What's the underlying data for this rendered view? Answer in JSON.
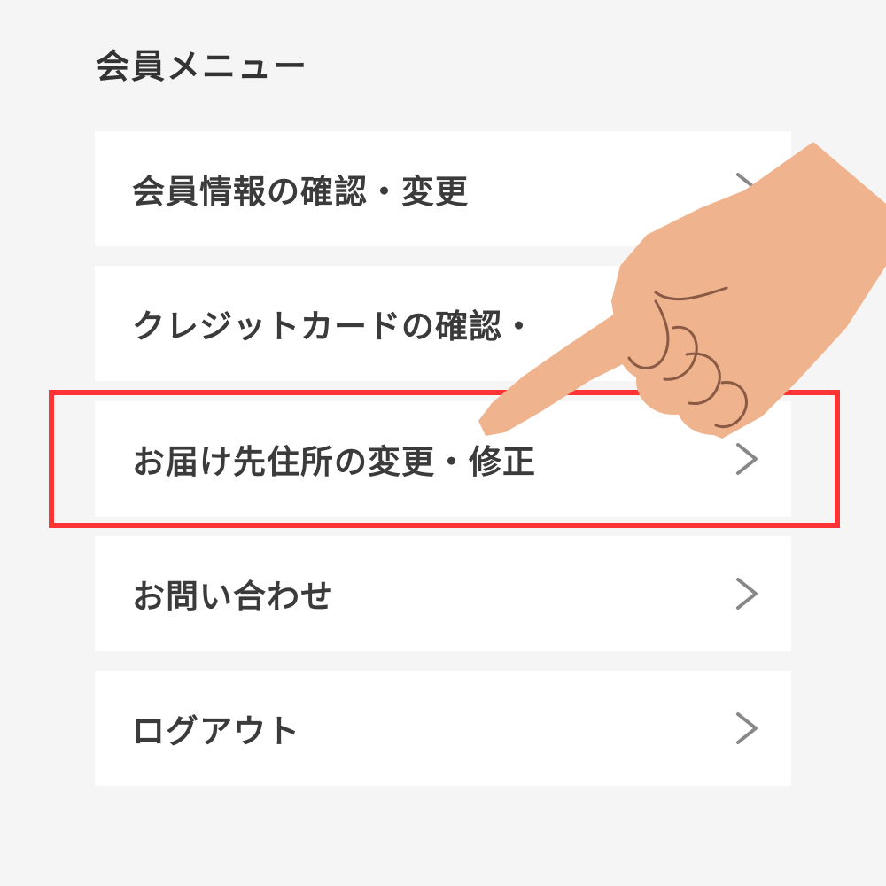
{
  "page": {
    "title": "会員メニュー",
    "highlight_color": "#ff3333",
    "skin_color": "#efb38e"
  },
  "menu": {
    "items": [
      {
        "label": "会員情報の確認・変更",
        "icon": "chevron-right-icon"
      },
      {
        "label": "クレジットカードの確認・",
        "icon": "chevron-right-icon"
      },
      {
        "label": "お届け先住所の変更・修正",
        "icon": "chevron-right-icon",
        "highlighted": true
      },
      {
        "label": "お問い合わせ",
        "icon": "chevron-right-icon"
      },
      {
        "label": "ログアウト",
        "icon": "chevron-right-icon"
      }
    ]
  }
}
